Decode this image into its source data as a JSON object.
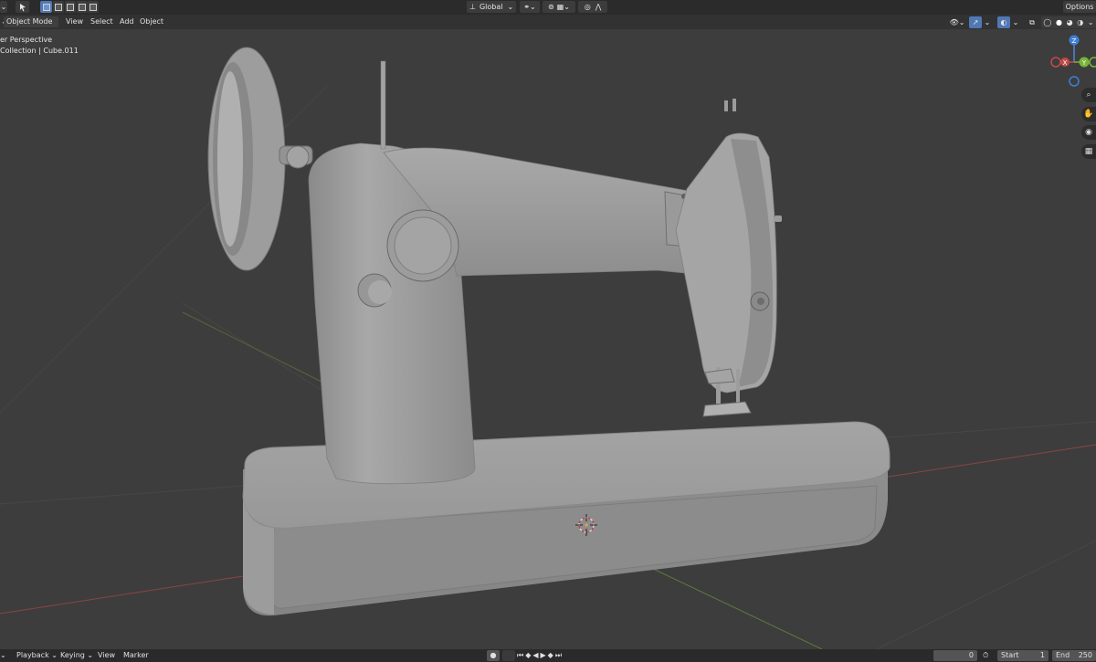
{
  "toolbar": {
    "transform_orientation": "Global",
    "options_label": "Options"
  },
  "header": {
    "mode": "Object Mode",
    "menus": [
      "View",
      "Select",
      "Add",
      "Object"
    ]
  },
  "viewport": {
    "view_name": "er Perspective",
    "collection_info": "Collection | Cube.011"
  },
  "timeline": {
    "menus": [
      "Playback",
      "Keying",
      "View",
      "Marker"
    ],
    "current_frame": "0",
    "start_label": "Start",
    "start_value": "1",
    "end_label": "End",
    "end_value": "250"
  },
  "gizmo": {
    "z_label": "Z",
    "y_label": "Y",
    "x_label": "X"
  },
  "colors": {
    "x_axis": "#c24a4a",
    "y_axis": "#7ab33a",
    "z_axis": "#3f7fd4",
    "background": "#3d3d3d"
  }
}
